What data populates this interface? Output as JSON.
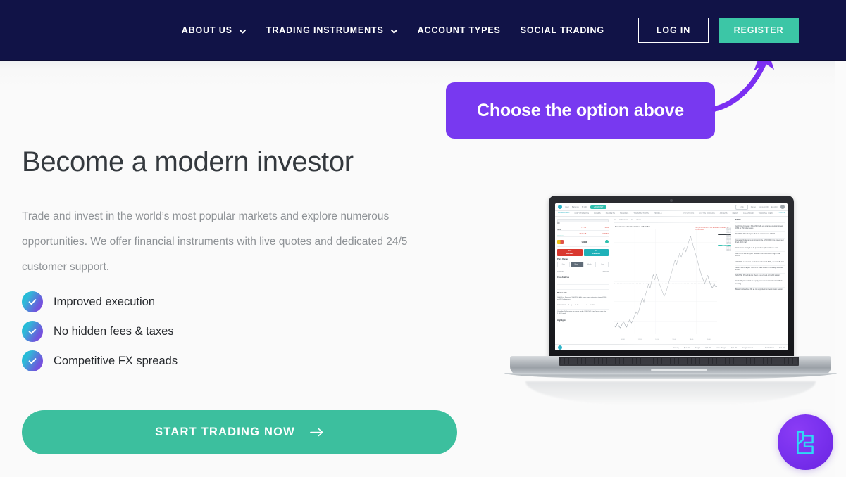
{
  "header": {
    "background_color": "#111347",
    "nav_items": [
      {
        "label": "ABOUT US",
        "has_dropdown": true,
        "icon": "chevron-down-icon"
      },
      {
        "label": "TRADING INSTRUMENTS",
        "has_dropdown": true,
        "icon": "chevron-down-icon"
      },
      {
        "label": "ACCOUNT TYPES",
        "has_dropdown": false
      },
      {
        "label": "SOCIAL TRADING",
        "has_dropdown": false
      }
    ],
    "login_label": "LOG IN",
    "register_label": "REGISTER",
    "register_color": "#3cc6a6"
  },
  "callout": {
    "text": "Choose the option above",
    "background_color": "#7839f0",
    "arrow_color": "#7b2ff2",
    "arrow_icon": "curved-arrow-up-icon"
  },
  "hero": {
    "title": "Become a modern investor",
    "subtitle": "Trade and invest in the world’s most popular markets and explore numerous opportunities. We offer financial instruments with live quotes and dedicated 24/5 customer support.",
    "features": [
      {
        "label": "Improved execution",
        "icon": "check-circle-icon"
      },
      {
        "label": "No hidden fees & taxes",
        "icon": "check-circle-icon"
      },
      {
        "label": "Competitive FX spreads",
        "icon": "check-circle-icon"
      }
    ],
    "cta_label": "START TRADING NOW",
    "cta_icon": "arrow-right-icon",
    "cta_color": "#3cbf9e"
  },
  "product_image": {
    "device": "laptop",
    "platform": {
      "top_bar": {
        "user_label": "User",
        "balance_label": "Balance",
        "balance_value": "$ 1.00",
        "deposit_label": "+ DEPOSIT",
        "live_label": "LIVE",
        "demo_label": "Demo",
        "account_label": "Account ID",
        "language": "English",
        "settings_icon": "gear-icon"
      },
      "tabs": [
        "DASHBOARD",
        "COPY TRADING",
        "FUNDS",
        "MARKETS",
        "TRADING",
        "TRANSACTIONS",
        "PROFILE"
      ],
      "right_tabs": [
        "POSITIONS",
        "ACTIVE ORDERS",
        "ASSETS",
        "NEWS",
        "CALENDAR",
        "TRADING IDEAS",
        "TOOLS"
      ],
      "search_placeholder": "Search...",
      "instruments": [
        {
          "name": "Oil",
          "sub": "WTI/USD",
          "bid": "73.56",
          "ask": "73.64"
        },
        {
          "name": "Gold",
          "sub": "XAU/USD",
          "bid": "1949.28",
          "ask": "1949.84"
        }
      ],
      "selected_instrument": "Gold",
      "sell_label": "SELL",
      "sell_price": "1949.28",
      "buy_label": "BUY",
      "buy_price": "1949.84",
      "price_range_title": "Price Range",
      "range_options": [
        "Day",
        "Week",
        "Month",
        "Year"
      ],
      "range_selected": "Week",
      "cost_title": "Cost Analysis",
      "market_title": "Market Info",
      "highlights_title": "Highlights",
      "chart_title": "Troy Ounce of Gold / Gold vs. US Dollar",
      "chart_warning": "Past performance is not a reliable indicator of future results",
      "toolbar_items": [
        "1h",
        "Indicators",
        "fx",
        "Draw"
      ],
      "y_ticks": [
        "1957.00",
        "1956.00",
        "1955.00",
        "1954.00",
        "1953.00",
        "1952.00",
        "1951.00",
        "1950.00",
        "1949.00",
        "1948.00",
        "1947.00",
        "1946.00",
        "1945.00",
        "1944.00",
        "1943.00"
      ],
      "price_tag": "1949.84",
      "price_tag_alt": "1949.28",
      "x_ticks": [
        "10:00",
        "12:00",
        "14:00",
        "16:00",
        "18:00",
        "20:00"
      ],
      "news_panel_title": "NEWS",
      "news_items": [
        "Gold Price Forecast: XAU/USD bulls eye a range extension toward 1950 as US Dollar eases",
        "EUR/USD Price Analysis: Bulls in control above 1.0900",
        "Canadian Dollar gains on strong crude, USD/CAD trims losses near the 1.3400 mark",
        "AUD retains strength vs its peers after upbeat Chinese data",
        "GBP/JPY Price Analysis: Retreats from multi-month highs near 181.00",
        "USD/CHF remains on the defensive below 0.8900, eyes on US data",
        "Silver Price Analysis: XAG/USD stalls below the 200-day SMA near 24.00",
        "NZD/USD Price Analysis: Bears eye a break of 0.6200 support",
        "Crude Oil prices climb as supply concerns mount ahead of OPEC meeting",
        "Bitcoin holds above 30k as risk appetite improves in Asian session"
      ],
      "bottom_stats": [
        {
          "label": "Equity",
          "value": "$ 1.00"
        },
        {
          "label": "Margin",
          "value": "$ 0.00"
        },
        {
          "label": "Free Margin",
          "value": "$ 1.00"
        },
        {
          "label": "Margin Level",
          "value": "—"
        },
        {
          "label": "Profit/Loss",
          "value": "$ 0.00"
        }
      ]
    },
    "chart_data": {
      "type": "line",
      "title": "Troy Ounce of Gold / Gold vs. US Dollar",
      "xlabel": "",
      "ylabel": "",
      "ylim": [
        1943,
        1958
      ],
      "x_ticks": [
        "10:00",
        "12:00",
        "14:00",
        "16:00",
        "18:00",
        "20:00"
      ],
      "grid": true,
      "series": [
        {
          "name": "XAU/USD",
          "values": [
            1944.2,
            1944.0,
            1944.6,
            1944.1,
            1943.9,
            1944.4,
            1944.8,
            1944.3,
            1944.0,
            1944.7,
            1945.1,
            1944.6,
            1945.0,
            1945.6,
            1946.2,
            1945.8,
            1946.5,
            1947.4,
            1948.2,
            1947.6,
            1948.6,
            1949.4,
            1950.2,
            1949.6,
            1950.6,
            1951.5,
            1950.8,
            1951.6,
            1950.9,
            1950.2,
            1949.6,
            1949.0,
            1948.4,
            1948.9,
            1949.6,
            1950.4,
            1951.2,
            1952.0,
            1952.8,
            1953.6,
            1953.0,
            1953.8,
            1954.6,
            1954.0,
            1954.8,
            1955.4,
            1954.8,
            1955.6,
            1956.4,
            1957.0,
            1956.2,
            1955.4,
            1954.6,
            1953.8,
            1953.0,
            1952.2,
            1951.4,
            1950.8,
            1950.2,
            1950.9,
            1951.4,
            1950.6,
            1950.0,
            1949.6,
            1950.2,
            1949.8,
            1949.84
          ]
        }
      ]
    }
  },
  "floating_logo": {
    "icon": "brand-monogram-icon",
    "background_color": "#7b32ef",
    "mark_color": "#2fd8f5"
  }
}
